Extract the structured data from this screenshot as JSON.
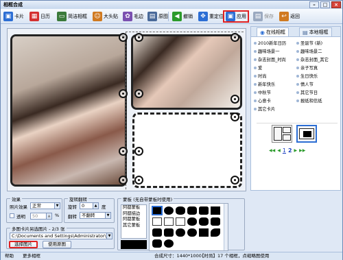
{
  "window": {
    "title": "相框合成"
  },
  "toolbar": {
    "items": [
      {
        "label": "卡片",
        "icon": "card-icon",
        "color": "#2c6ed4"
      },
      {
        "label": "日历",
        "icon": "calendar-icon",
        "color": "#d43030"
      },
      {
        "label": "简洁相框",
        "icon": "frame-icon",
        "color": "#3a7a3a"
      },
      {
        "label": "大头贴",
        "icon": "sticker-icon",
        "color": "#d07a20"
      },
      {
        "label": "毛边",
        "icon": "rough-edge-icon",
        "color": "#7a50b0"
      },
      {
        "label": "原图",
        "icon": "original-image-icon",
        "color": "#4a6a9a"
      },
      {
        "label": "撤销",
        "icon": "undo-icon",
        "color": "#2a9a2a"
      },
      {
        "label": "重定位",
        "icon": "reposition-icon",
        "color": "#2c6ed4"
      },
      {
        "label": "应用",
        "icon": "apply-icon",
        "color": "#2c6ed4"
      },
      {
        "label": "保存",
        "icon": "save-icon",
        "color": "#9aa9c0"
      },
      {
        "label": "返回",
        "icon": "back-icon",
        "color": "#d07a20"
      }
    ]
  },
  "right_panel": {
    "tab_online": "在线相框",
    "tab_local": "本地相框",
    "categories": [
      "2010新年日历",
      "圣诞节 (新)",
      "趣味场景一",
      "趣味场景二",
      "杂志封面_时尚",
      "杂志封面_其它",
      "爱",
      "亲子写真",
      "时尚",
      "生日快乐",
      "新年快乐",
      "情人节",
      "中秋节",
      "其它节日",
      "心意卡",
      "报纸和信纸",
      "其它卡片"
    ],
    "pager": {
      "prev_first": "◀◀",
      "prev": "◀",
      "page1": "1",
      "page2": "2",
      "next": "▶",
      "next_last": "▶▶"
    }
  },
  "effects": {
    "title": "效果",
    "photo_effect_label": "照片效果",
    "photo_effect_value": "正常",
    "transparent_label": "透明",
    "transparent_value": "50",
    "percent": "%"
  },
  "rotate": {
    "title": "旋转翻转",
    "rotate_label": "旋转",
    "rotate_value": "0",
    "degree": "度",
    "flip_label": "翻转",
    "flip_value": "不翻转"
  },
  "multi": {
    "title": "多图卡片另选图片 - 2/3 张",
    "path": "C:\\Documents and Settings\\Administrator\\桌面\\1\\最爱",
    "choose_button": "选择图片",
    "use_original_button": "使用原图"
  },
  "masks": {
    "title": "蒙板 (无自带蒙板时使用)",
    "list": [
      "阿都蒙板",
      "阿都描边",
      "阿都蒙板",
      "其它蒙板"
    ]
  },
  "status": {
    "help": "帮助",
    "more_frames": "更多相框",
    "size": "合成尺寸：1440*1000",
    "hint": "【时尚】17 个相框，点缩略图使用"
  }
}
